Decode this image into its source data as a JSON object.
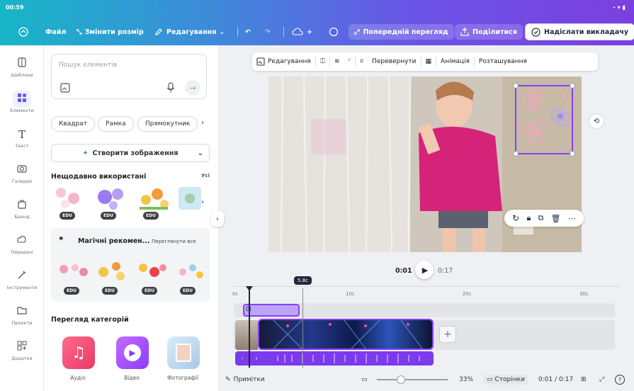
{
  "status_bar": {
    "time": "00:59",
    "right": "⁃ ▾ ▮"
  },
  "topbar": {
    "file": "Файл",
    "resize": "Змінити розмір",
    "editing": "Редагування",
    "preview": "Попередній перегляд",
    "share": "Поділитися",
    "send_teacher": "Надіслати викладачу"
  },
  "rail": [
    {
      "label": "Шаблони",
      "icon": "templates-icon"
    },
    {
      "label": "Елементи",
      "icon": "elements-icon"
    },
    {
      "label": "Текст",
      "icon": "text-icon"
    },
    {
      "label": "Галерея",
      "icon": "gallery-icon"
    },
    {
      "label": "Бренд",
      "icon": "brand-icon"
    },
    {
      "label": "Передані",
      "icon": "uploads-icon"
    },
    {
      "label": "Інструменти",
      "icon": "tools-icon"
    },
    {
      "label": "Проекти",
      "icon": "projects-icon"
    },
    {
      "label": "Додатки",
      "icon": "apps-icon"
    }
  ],
  "panel": {
    "search_placeholder": "Пошук елементів",
    "chips": [
      "Квадрат",
      "Рамка",
      "Прямокутник"
    ],
    "generate": "Створити зображення",
    "recent_title": "Нещодавно використані",
    "recent_more": "Усі",
    "edu_badge": "EDU",
    "magic_title": "Магічні рекомен...",
    "magic_more": "Переглянути все",
    "categories_title": "Перегляд категорій",
    "categories": [
      "Аудіо",
      "Відео",
      "Фотографії"
    ]
  },
  "context_bar": {
    "edit": "Редагування",
    "flip": "Перевернути",
    "animation": "Анімація",
    "position": "Розташування"
  },
  "player": {
    "current": "0:01",
    "total": "0:17"
  },
  "timeline": {
    "ticks": [
      "0с",
      "10с",
      "20с",
      "30с"
    ],
    "tooltip": "5.8с"
  },
  "bottom_bar": {
    "notes": "Примітки",
    "zoom": "33%",
    "pages": "Сторінки",
    "time": "0:01 / 0:17"
  },
  "colors": {
    "accent": "#8b3dff",
    "topbar_start": "#17b6c7",
    "topbar_end": "#7b3fe0"
  }
}
